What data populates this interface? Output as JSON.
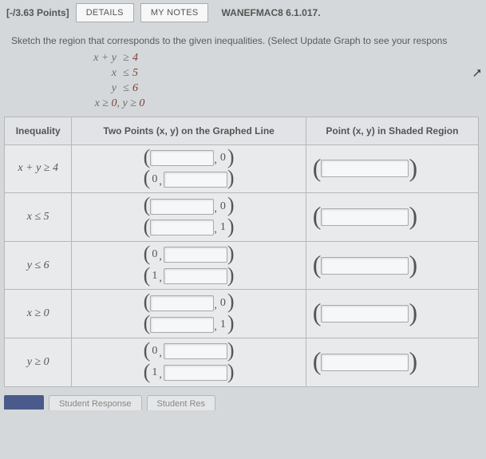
{
  "header": {
    "points": "[-/3.63 Points]",
    "details_btn": "DETAILS",
    "mynotes_btn": "MY NOTES",
    "code": "WANEFMAC8 6.1.017."
  },
  "instruction": "Sketch the region that corresponds to the given inequalities. (Select Update Graph to see your respons",
  "system": {
    "row1": {
      "lhs": "x + y",
      "op": "≥",
      "rhs": "4"
    },
    "row2": {
      "lhs": "x",
      "op": "≤",
      "rhs": "5"
    },
    "row3": {
      "lhs": "y",
      "op": "≤",
      "rhs": "6"
    },
    "row4": "x ≥ 0, y ≥ 0"
  },
  "columns": {
    "c1": "Inequality",
    "c2": "Two Points (x, y) on the Graphed Line",
    "c3": "Point (x, y) in Shaded Region"
  },
  "rows": [
    {
      "ineq": "x + y ≥ 4",
      "p1_fixed_pos": "after",
      "p1_fixed": "0",
      "p2_fixed_pos": "before",
      "p2_fixed": "0"
    },
    {
      "ineq": "x ≤ 5",
      "p1_fixed_pos": "after",
      "p1_fixed": "0",
      "p2_fixed_pos": "after",
      "p2_fixed": "1"
    },
    {
      "ineq": "y ≤ 6",
      "p1_fixed_pos": "before",
      "p1_fixed": "0",
      "p2_fixed_pos": "before",
      "p2_fixed": "1"
    },
    {
      "ineq": "x ≥ 0",
      "p1_fixed_pos": "after",
      "p1_fixed": "0",
      "p2_fixed_pos": "after",
      "p2_fixed": "1"
    },
    {
      "ineq": "y ≥ 0",
      "p1_fixed_pos": "before",
      "p1_fixed": "0",
      "p2_fixed_pos": "before",
      "p2_fixed": "1"
    }
  ],
  "footer": {
    "tab1": "Student Response",
    "tab2": "Student Res"
  }
}
